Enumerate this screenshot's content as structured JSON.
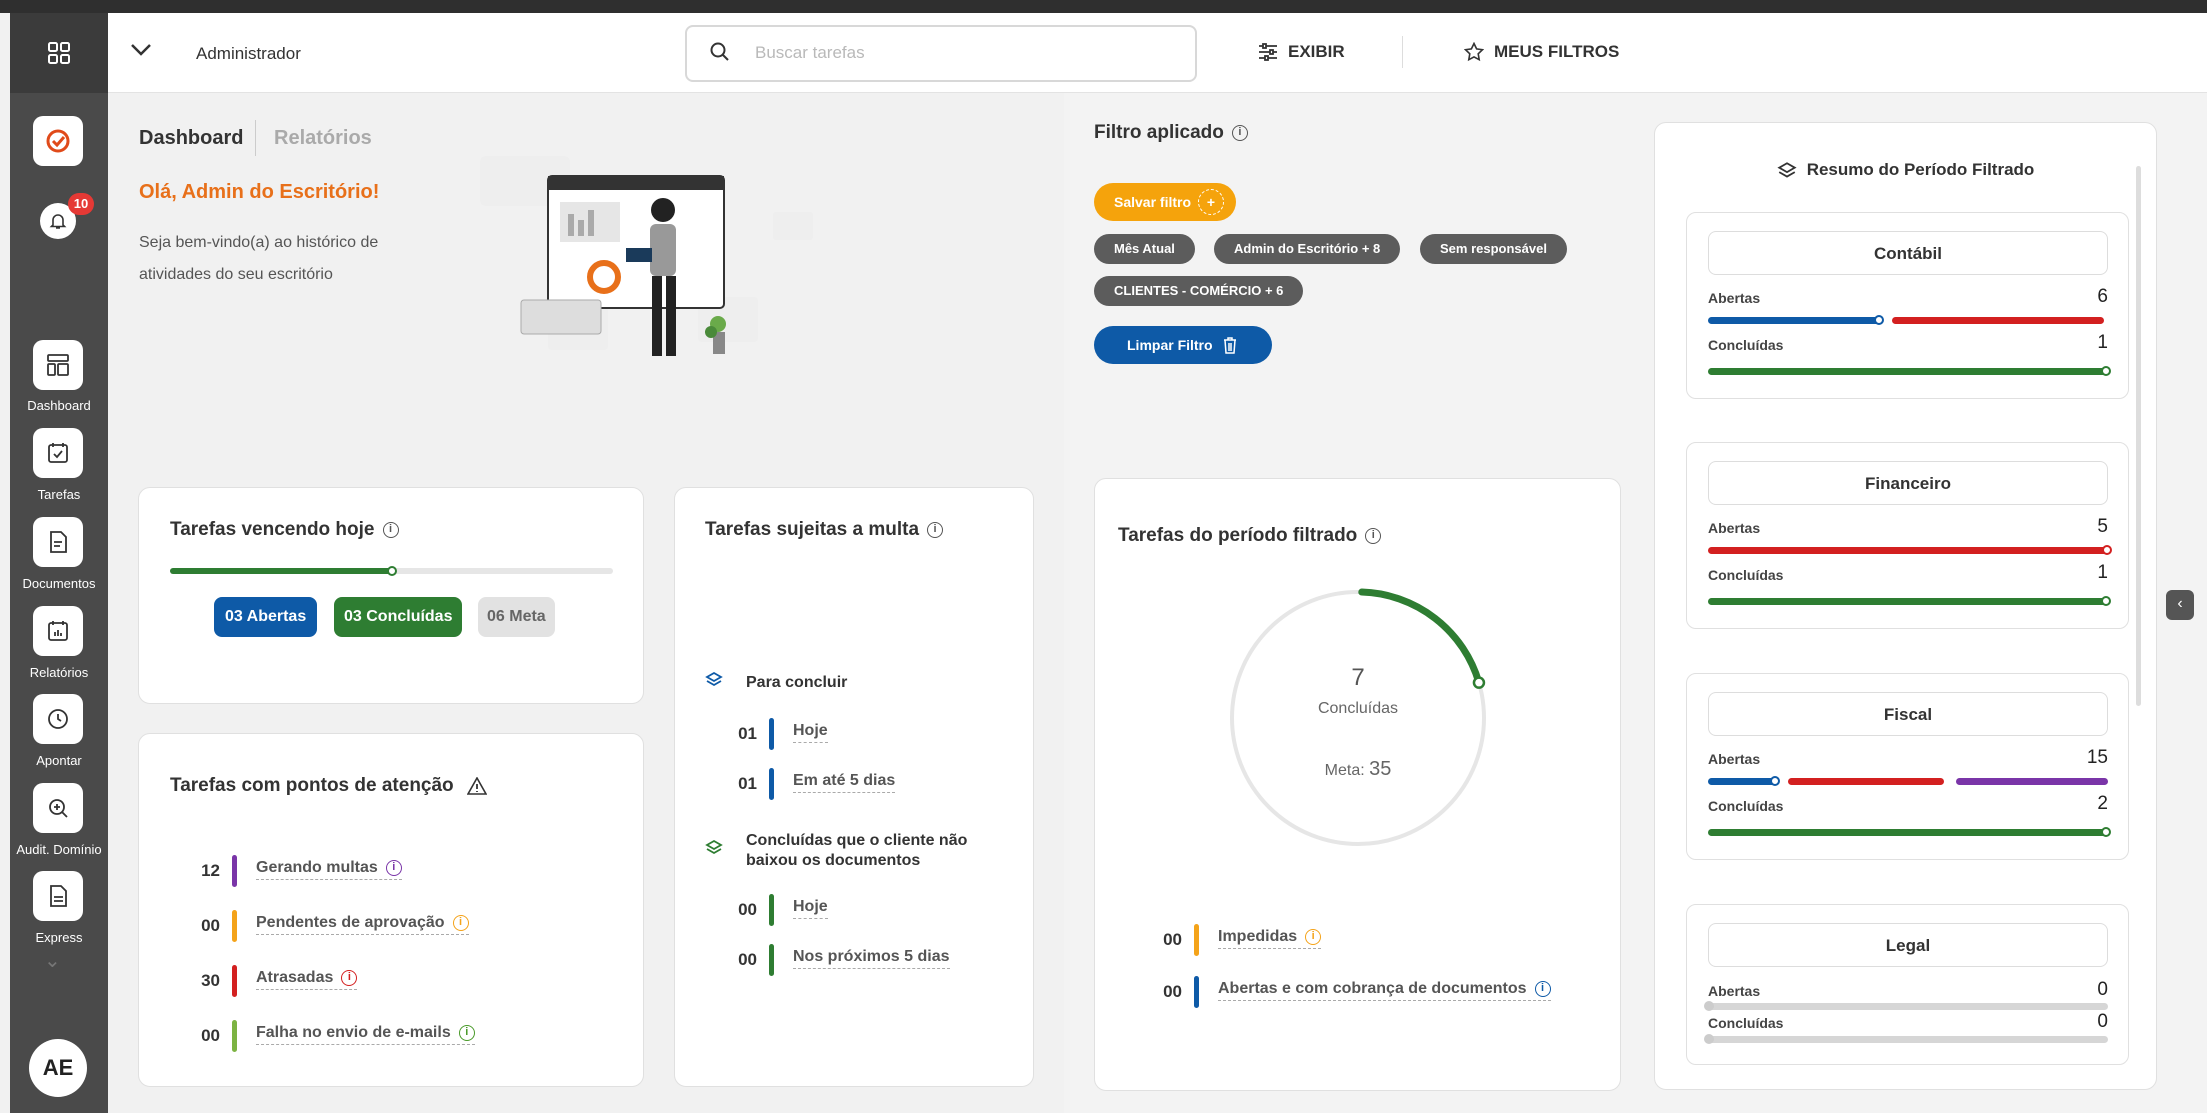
{
  "header": {
    "user": "Administrador",
    "search_placeholder": "Buscar tarefas",
    "exibir": "EXIBIR",
    "meus_filtros": "MEUS FILTROS"
  },
  "sidebar": {
    "badge": "10",
    "avatar": "AE",
    "items": [
      {
        "label": "Dashboard"
      },
      {
        "label": "Tarefas"
      },
      {
        "label": "Documentos"
      },
      {
        "label": "Relatórios"
      },
      {
        "label": "Apontar"
      },
      {
        "label": "Audit. Domínio"
      },
      {
        "label": "Express"
      }
    ]
  },
  "tabs": {
    "dashboard": "Dashboard",
    "relatorios": "Relatórios"
  },
  "welcome": {
    "greeting": "Olá, Admin do Escritório!",
    "line1": "Seja bem-vindo(a) ao histórico de",
    "line2": "atividades do seu escritório"
  },
  "vencendo": {
    "title": "Tarefas vencendo hoje",
    "progress": 0.5,
    "abertas": "03 Abertas",
    "concluidas": "03 Concluídas",
    "meta": "06 Meta"
  },
  "atencao": {
    "title": "Tarefas com pontos de atenção",
    "rows": [
      {
        "num": "12",
        "label": "Gerando multas",
        "color": "#7a35a8"
      },
      {
        "num": "00",
        "label": "Pendentes de aprovação",
        "color": "#f4a31a"
      },
      {
        "num": "30",
        "label": "Atrasadas",
        "color": "#d32020"
      },
      {
        "num": "00",
        "label": "Falha no envio de e-mails",
        "color": "#7cb342"
      }
    ]
  },
  "multa": {
    "title": "Tarefas sujeitas a multa",
    "para_concluir": "Para concluir",
    "rows1": [
      {
        "num": "01",
        "label": "Hoje"
      },
      {
        "num": "01",
        "label": "Em até 5 dias"
      }
    ],
    "concluidas_title1": "Concluídas que o cliente não",
    "concluidas_title2": "baixou os documentos",
    "rows2": [
      {
        "num": "00",
        "label": "Hoje"
      },
      {
        "num": "00",
        "label": "Nos próximos 5 dias"
      }
    ]
  },
  "filtro": {
    "title": "Filtro aplicado",
    "salvar": "Salvar filtro",
    "chips": [
      "Mês Atual",
      "Admin do Escritório + 8",
      "Sem responsável",
      "CLIENTES - COMÉRCIO + 6"
    ],
    "limpar": "Limpar Filtro"
  },
  "periodo": {
    "title": "Tarefas do período filtrado",
    "value": "7",
    "label": "Concluídas",
    "meta_label": "Meta:",
    "meta": "35",
    "fraction": 0.2,
    "rows": [
      {
        "num": "00",
        "label": "Impedidas",
        "color": "#f4a31a"
      },
      {
        "num": "00",
        "label": "Abertas e com cobrança de documentos",
        "color": "#0e5aa7"
      }
    ]
  },
  "resumo": {
    "title": "Resumo do Período Filtrado",
    "abertas_label": "Abertas",
    "concluidas_label": "Concluídas",
    "cards": [
      {
        "name": "Contábil",
        "abertas": "6",
        "concluidas": "1"
      },
      {
        "name": "Financeiro",
        "abertas": "5",
        "concluidas": "1"
      },
      {
        "name": "Fiscal",
        "abertas": "15",
        "concluidas": "2"
      },
      {
        "name": "Legal",
        "abertas": "0",
        "concluidas": "0"
      }
    ]
  },
  "colors": {
    "blue": "#0e5aa7",
    "green": "#2e7d32",
    "orange": "#f5a30c",
    "red": "#d32020",
    "purple": "#7a35a8",
    "brand_orange": "#e8701a"
  }
}
